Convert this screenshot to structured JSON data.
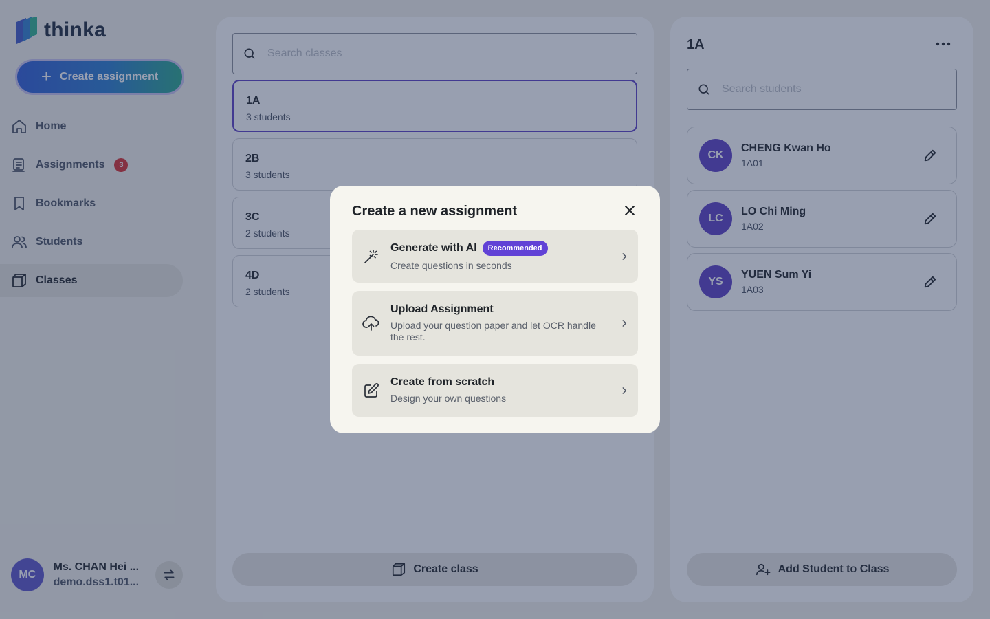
{
  "app": {
    "name": "thinka"
  },
  "sidebar": {
    "create_label": "Create assignment",
    "items": [
      {
        "label": "Home",
        "icon": "home-icon"
      },
      {
        "label": "Assignments",
        "icon": "assignments-icon",
        "badge": "3"
      },
      {
        "label": "Bookmarks",
        "icon": "bookmark-icon"
      },
      {
        "label": "Students",
        "icon": "users-icon"
      },
      {
        "label": "Classes",
        "icon": "box-icon",
        "active": true
      }
    ],
    "user": {
      "initials": "MC",
      "name": "Ms. CHAN Hei ...",
      "email": "demo.dss1.t01..."
    }
  },
  "classes": {
    "search_placeholder": "Search classes",
    "list": [
      {
        "name": "1A",
        "count": "3 students",
        "selected": true
      },
      {
        "name": "2B",
        "count": "3 students"
      },
      {
        "name": "3C",
        "count": "2 students"
      },
      {
        "name": "4D",
        "count": "2 students"
      }
    ],
    "create_label": "Create class"
  },
  "detail": {
    "title": "1A",
    "search_placeholder": "Search students",
    "students": [
      {
        "initials": "CK",
        "name": "CHENG Kwan Ho",
        "id": "1A01"
      },
      {
        "initials": "LC",
        "name": "LO Chi Ming",
        "id": "1A02"
      },
      {
        "initials": "YS",
        "name": "YUEN Sum Yi",
        "id": "1A03"
      }
    ],
    "add_label": "Add Student to Class"
  },
  "modal": {
    "title": "Create a new assignment",
    "options": [
      {
        "title": "Generate with AI",
        "badge": "Recommended",
        "desc": "Create questions in seconds",
        "icon": "magic-wand-icon"
      },
      {
        "title": "Upload Assignment",
        "desc": "Upload your question paper and let OCR handle the rest.",
        "icon": "cloud-upload-icon"
      },
      {
        "title": "Create from scratch",
        "desc": "Design your own questions",
        "icon": "edit-square-icon"
      }
    ]
  },
  "colors": {
    "accent": "#5b3fc4",
    "badge": "#d92d2d",
    "pill": "#6142d6",
    "overlay": "rgba(40,55,90,0.48)"
  }
}
